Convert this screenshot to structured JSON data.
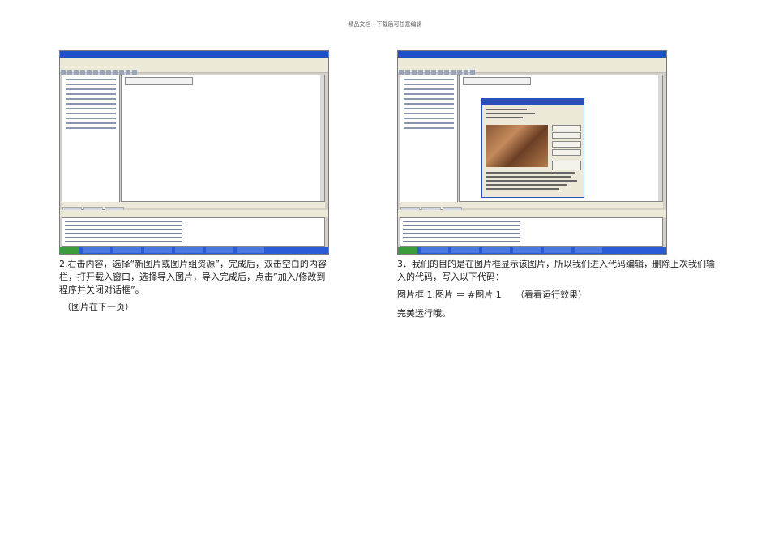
{
  "page": {
    "header": "精品文档---下载后可任意编辑"
  },
  "figures": {
    "left": {
      "icon": "ide-screenshot"
    },
    "right": {
      "icon": "ide-screenshot-with-image-dialog"
    }
  },
  "left_column": {
    "step_text": "2.右击内容，选择“新图片或图片组资源”，完成后，双击空白的内容栏，打开载入窗口，选择导入图片，导入完成后，点击”加入/修改到程序并关闭对话框”。",
    "note": "（图片在下一页）"
  },
  "right_column": {
    "step_text": "3．我们的目的是在图片框显示该图片，所以我们进入代码编辑，删除上次我们输入的代码，写入以下代码：",
    "code": "图片框 1.图片 ＝ #图片 1",
    "code_comment": "（看看运行效果）",
    "result": "完美运行哦。"
  }
}
